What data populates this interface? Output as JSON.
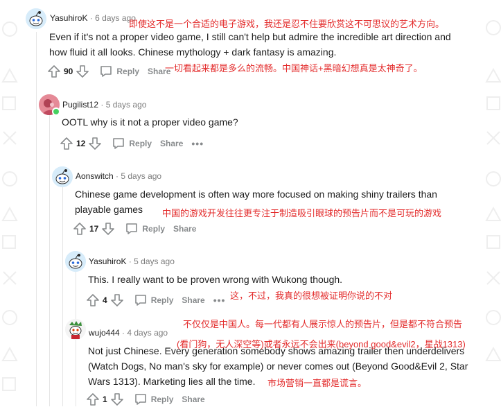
{
  "comments": [
    {
      "username": "YasuhiroK",
      "age": "6 days ago",
      "lines": [
        "Even if it's not a proper video game, I still can't help but admire the incredible art direction and",
        "how fluid it all looks. Chinese mythology + dark fantasy is amazing."
      ],
      "score": "90",
      "reply_label": "Reply",
      "share_label": "Share"
    },
    {
      "username": "Pugilist12",
      "age": "5 days ago",
      "lines": [
        "OOTL why is it not a proper video game?"
      ],
      "score": "12",
      "reply_label": "Reply",
      "share_label": "Share",
      "more_label": "•••"
    },
    {
      "username": "Aonswitch",
      "age": "5 days ago",
      "lines": [
        "Chinese game development is often way more focused on making shiny trailers than",
        "playable games"
      ],
      "score": "17",
      "reply_label": "Reply",
      "share_label": "Share"
    },
    {
      "username": "YasuhiroK",
      "age": "5 days ago",
      "lines": [
        "This. I really want to be proven wrong with Wukong though."
      ],
      "score": "4",
      "reply_label": "Reply",
      "share_label": "Share",
      "more_label": "•••"
    },
    {
      "username": "wujo444",
      "age": "4 days ago",
      "lines": [
        "Not just Chinese. Every generation somebody shows amazing trailer then underdelivers",
        "(Watch Dogs, No man's sky for example) or never comes out (Beyond Good&Evil 2, Star",
        "Wars 1313). Marketing lies all the time."
      ],
      "score": "1",
      "reply_label": "Reply",
      "share_label": "Share"
    }
  ],
  "annotations": {
    "a1": "即使这不是一个合适的电子游戏，我还是忍不住要欣赏这不可思议的艺术方向。",
    "a2": "一切看起来都是多么的流畅。中国神话+黑暗幻想真是太神奇了。",
    "a3": "中国的游戏开发往往更专注于制造吸引眼球的预告片而不是可玩的游戏",
    "a4": "这，不过，我真的很想被证明你说的不对",
    "a5": "不仅仅是中国人。每一代都有人展示惊人的预告片，但是都不符合预告",
    "a6": "(看门狗，无人深空等)或者永远不会出来(beyond good&evil2，星战1313)",
    "a7": "市场营销一直都是谎言。"
  },
  "colors": {
    "annotation": "#e32b2b",
    "meta": "#7c7c7c",
    "icon": "#878a8c"
  }
}
